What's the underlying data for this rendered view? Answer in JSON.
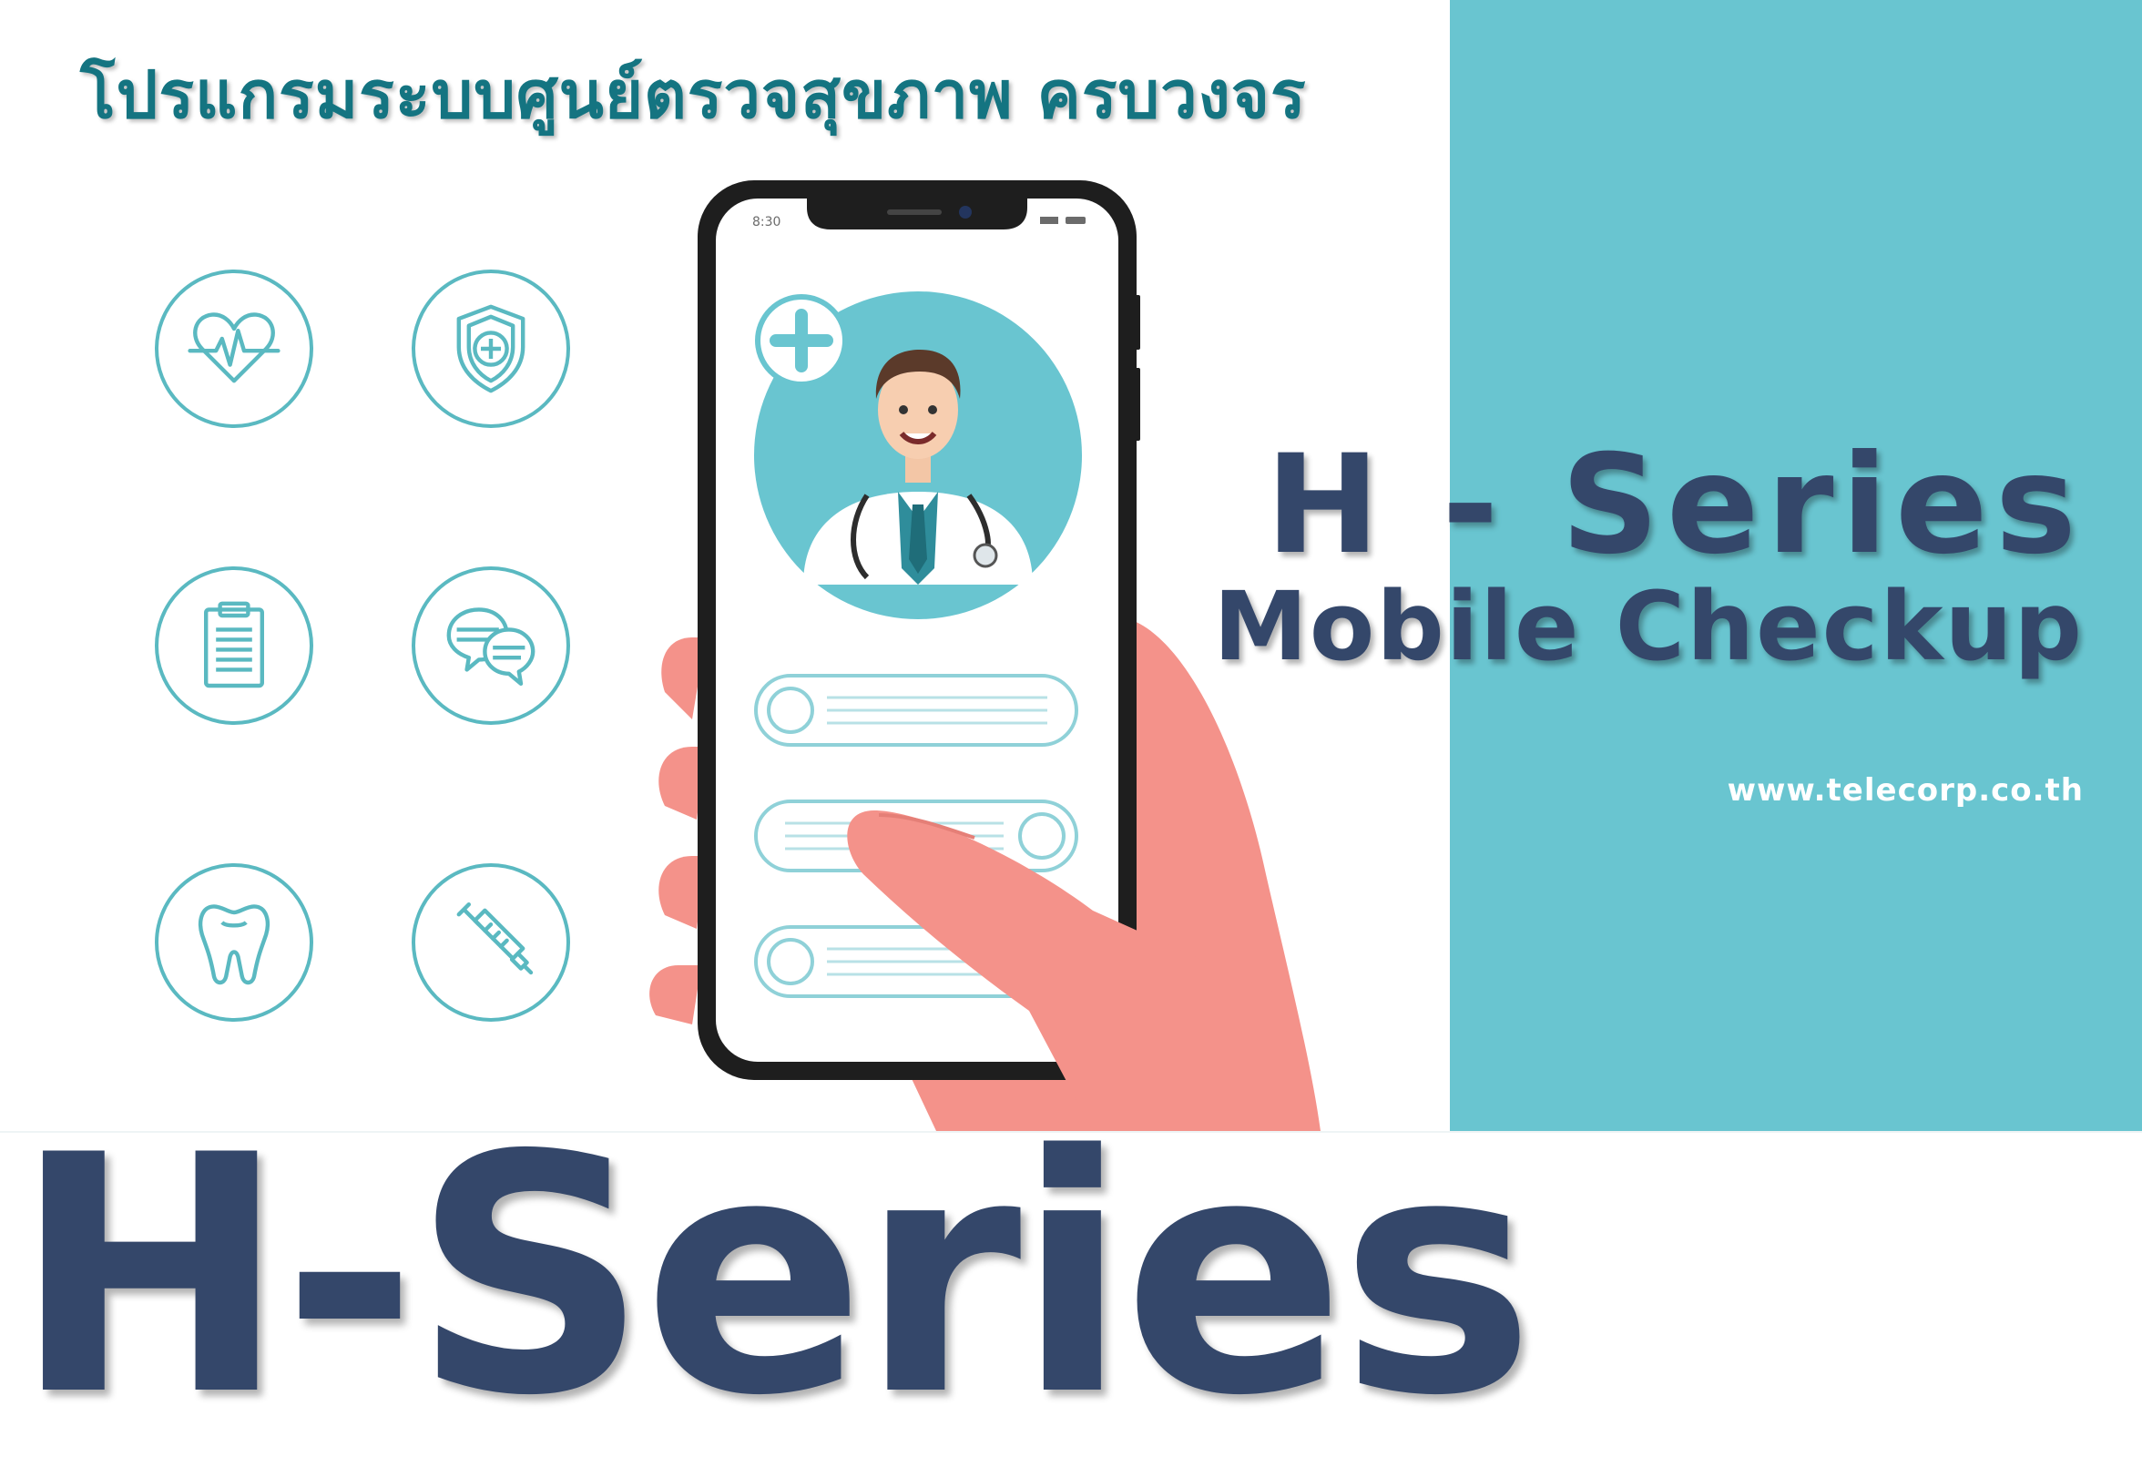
{
  "header": {
    "thai_title": "โปรแกรมระบบศูนย์ตรวจสุขภาพ ครบวงจร"
  },
  "icons": [
    {
      "name": "heartbeat-icon"
    },
    {
      "name": "shield-plus-icon"
    },
    {
      "name": "clipboard-icon"
    },
    {
      "name": "chat-bubbles-icon"
    },
    {
      "name": "tooth-icon"
    },
    {
      "name": "syringe-icon"
    }
  ],
  "phone": {
    "status_time": "8:30"
  },
  "product": {
    "series_title": "H - Series",
    "subtitle": "Mobile Checkup",
    "website": "www.telecorp.co.th",
    "brand": "H-Series"
  },
  "colors": {
    "teal_panel": "#69c5d0",
    "navy_text": "#34476a",
    "thai_title": "#147481",
    "icon_stroke": "#5ab9c1",
    "hand_skin": "#f4928a"
  }
}
